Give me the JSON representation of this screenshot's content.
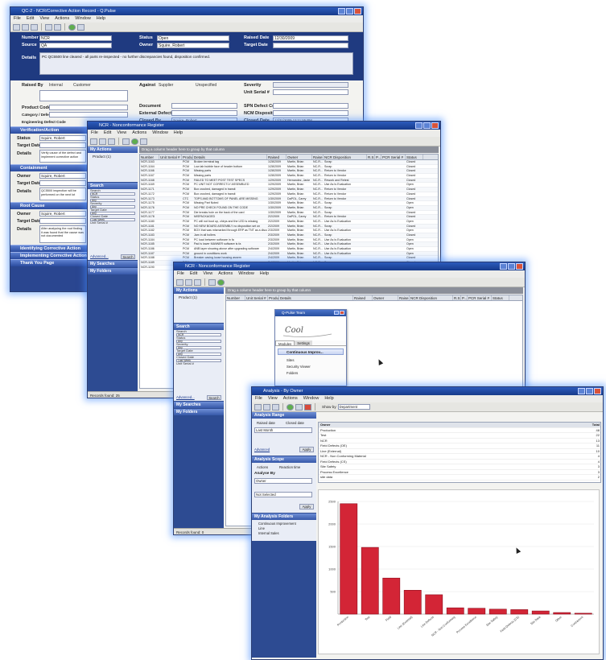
{
  "colors": {
    "navy": "#1c3474",
    "title_blue": "#2c5bbd",
    "glow": "#4b8cff",
    "bar_red": "#d32536",
    "group_gray": "#8b8f99"
  },
  "window1": {
    "title": "QC-2 - NCR/Corrective Action Record - Q.Pulse",
    "menu": [
      "File",
      "Edit",
      "View",
      "Actions",
      "Window",
      "Help"
    ],
    "fields": {
      "number_label": "Number",
      "number_value": "NCR",
      "source_label": "Source",
      "source_value": "QA",
      "status_label": "Status",
      "status_value": "Open",
      "owner_label": "Owner",
      "owner_value": "Squire, Robert",
      "raised_date_label": "Raised Date",
      "raised_date_value": "12/30/2009",
      "target_date_label": "Target Date",
      "details_label": "Details",
      "raised_by_label": "Raised By",
      "against_label": "Against",
      "severity_label": "Severity",
      "unit_serial_label": "Unit Serial #",
      "product_code_label": "Product Code",
      "category_label": "Category / Defect Code",
      "engineering_label": "Engineering Defect Code",
      "document_label": "Document",
      "external_ref_label": "External Defect Code",
      "closed_by_label": "Closed By",
      "closed_by_value": "Squire, Robert",
      "closed_date_label": "Closed Date",
      "closed_date_value": "12/31/2009 12:11:55 PM",
      "spn_label": "SPN Defect Code",
      "ncm_label": "NCM Disposition",
      "internal_option": "Internal",
      "customer_option": "Customer",
      "supplier_option": "Supplier",
      "specified_option": "Unspecified"
    },
    "details_text": "PC QC5500 line cleared - all parts re-inspected - no further discrepancies found, disposition confirmed.",
    "sections": [
      {
        "title": "Verification/Action",
        "status_label": "Status",
        "status": "Open",
        "owner_label": "Owner",
        "owner": "Squire, Robert",
        "target_label": "Target Date",
        "details_label": "Details",
        "details": "Verify cause of the defect and implement corrective action"
      },
      {
        "title": "Containment",
        "status_label": "Status",
        "status": "Open",
        "owner_label": "Owner",
        "owner": "Squire, Robert",
        "target_label": "Target Date",
        "details_label": "Details",
        "details": "QC5500 inspection will be performed on the next lot"
      },
      {
        "title": "Root Cause",
        "status_label": "Status",
        "status": "Open",
        "owner_label": "Owner",
        "owner": "Squire, Robert",
        "target_label": "Target Date",
        "details_label": "Details",
        "details": "After analysing the root finding it was found that the cause was not documented"
      }
    ],
    "collapsed_sections": [
      "Identifying Corrective Action",
      "Implementing Corrective Action",
      "Thank You Page"
    ]
  },
  "window2": {
    "title": "NCR - Nonconformance Register",
    "menu": [
      "File",
      "Edit",
      "View",
      "Actions",
      "Window",
      "Help"
    ],
    "nav": {
      "my_actions": "My Actions",
      "actions_item": "Product (1)",
      "search": "Search",
      "search_button": "Search",
      "advanced": "Advanced...",
      "my_searches": "My Searches",
      "my_folders": "My Folders",
      "fields": [
        "Search",
        "NCR",
        "Status",
        "Any",
        "Severity",
        "Any",
        "Target Date",
        "Any",
        "Closed Date",
        "Last Week",
        "Unit Serial #"
      ]
    },
    "group_bar": "Drag a column header here to group by that column",
    "columns": [
      "Number",
      "Unit Serial #",
      "Produ...",
      "Details",
      "Raised",
      "Owner",
      "Raise...",
      "NCR Disposition",
      "R.S.",
      "P...",
      "PCR Serial #",
      "Status"
    ],
    "rows": [
      [
        "NCR-1163",
        "",
        "PCM",
        "Broken terminal tag",
        "1/28/2009",
        "Martin, Brian",
        "NC-R...",
        "Scrap",
        "",
        "",
        "",
        "Closed"
      ],
      [
        "NCR-1164",
        "",
        "PCM",
        "Low lab bubble face of header bottom",
        "1/28/2009",
        "Martin, Brian",
        "NC-R...",
        "Scrap",
        "",
        "",
        "",
        "Closed"
      ],
      [
        "NCR-1166",
        "",
        "PCM",
        "Missing parts",
        "1/28/2009",
        "Martin, Brian",
        "NC-R...",
        "Return to Vendor",
        "",
        "",
        "",
        "Closed"
      ],
      [
        "NCR-1167",
        "",
        "PCM",
        "Missing parts",
        "1/28/2009",
        "Martin, Brian",
        "NC-R...",
        "Return to Vendor",
        "",
        "",
        "",
        "Closed"
      ],
      [
        "NCR-1168",
        "",
        "PCM",
        "FAILED TO MEET POST TEST SPECS",
        "1/29/2009",
        "Hernandez, Janie",
        "NC-R...",
        "Rework and Retest",
        "",
        "",
        "",
        "Closed"
      ],
      [
        "NCR-1169",
        "",
        "PCM",
        "PC UNIT NOT CORRECTLY ASSEMBLED",
        "1/29/2009",
        "Martin, Brian",
        "NC-R...",
        "Use As Is Evaluation",
        "",
        "",
        "",
        "Open"
      ],
      [
        "NCR-1171",
        "",
        "PCM",
        "Box crushed, damaged in transit",
        "1/29/2009",
        "Martin, Brian",
        "NC-R...",
        "Return to Vendor",
        "",
        "",
        "",
        "Closed"
      ],
      [
        "NCR-1172",
        "",
        "PCM",
        "Box crushed, damaged in transit",
        "1/29/2009",
        "Martin, Brian",
        "NC-R...",
        "Return to Vendor",
        "",
        "",
        "",
        "Closed"
      ],
      [
        "NCR-1173",
        "",
        "CTC",
        "TOPS AND BOTTOMS OF PANEL ARE MISSING",
        "1/30/2009",
        "DaPOL, Carey",
        "NC-R...",
        "Return to Vendor",
        "",
        "",
        "",
        "Closed"
      ],
      [
        "NCR-1175",
        "",
        "PCM",
        "Missing Part Noted",
        "1/30/2009",
        "Martin, Brian",
        "NC-R...",
        "Scrap",
        "",
        "",
        "",
        "Open"
      ],
      [
        "NCR-1176",
        "",
        "PCM",
        "NO PRE CHECK FOUND ON THE CODE",
        "1/30/2009",
        "Martin, Brian",
        "NC-R...",
        "Scrap",
        "",
        "",
        "",
        "Open"
      ],
      [
        "NCR-1177",
        "",
        "PCM",
        "Die breaks hole on the back of the card",
        "1/30/2009",
        "Martin, Brian",
        "NC-R...",
        "Scrap",
        "",
        "",
        "",
        "Closed"
      ],
      [
        "NCR-1178",
        "",
        "PCM",
        "MISPACKAGED",
        "2/2/2009",
        "DaPOL, Carey",
        "NC-R...",
        "Return to Vendor",
        "",
        "",
        "",
        "Closed"
      ],
      [
        "NCR-1180",
        "",
        "PCM",
        "PC will not boot up, chirps and the LED is missing",
        "2/2/2009",
        "Martin, Brian",
        "NC-R...",
        "Use As Is Evaluation",
        "",
        "",
        "",
        "Open"
      ],
      [
        "NCR-1181",
        "",
        "PCM",
        "NO NEW BOARD ASSEMBLY no disposition set on",
        "2/2/2009",
        "Martin, Brian",
        "NC-R...",
        "Scrap",
        "",
        "",
        "",
        "Closed"
      ],
      [
        "NCR-1182",
        "",
        "PCM",
        "BOX that was mismarked through ERP as TNT as a discount",
        "2/3/2009",
        "Martin, Brian",
        "NC-R...",
        "Use As Is Evaluation",
        "",
        "",
        "",
        "Open"
      ],
      [
        "NCR-1183",
        "",
        "PCM",
        "Jam in all hollers",
        "2/3/2009",
        "Martin, Brian",
        "NC-R...",
        "Scrap",
        "",
        "",
        "",
        "Closed"
      ],
      [
        "NCR-1184",
        "",
        "PCM",
        "PC load between software in fa",
        "2/3/2009",
        "Martin, Brian",
        "NC-R...",
        "Use As Is Evaluation",
        "",
        "",
        "",
        "Open"
      ],
      [
        "NCR-1185",
        "",
        "PCM",
        "Pad is lower MANNER software is fa",
        "2/3/2009",
        "Martin, Brian",
        "NC-R...",
        "Use As Is Evaluation",
        "",
        "",
        "",
        "Open"
      ],
      [
        "NCR-1186",
        "",
        "PCM",
        "ANB layer showing above after upgrading software",
        "2/4/2009",
        "Martin, Brian",
        "NC-R...",
        "Use As Is Evaluation",
        "",
        "",
        "",
        "Open"
      ],
      [
        "NCR-1187",
        "",
        "PCM",
        "ground in conditions work",
        "2/4/2009",
        "Martin, Brian",
        "NC-R...",
        "Use As Is Evaluation",
        "",
        "",
        "",
        "Open"
      ],
      [
        "NCR-1188",
        "",
        "PCM",
        "Breaker casing loose housing assem",
        "2/4/2009",
        "Martin, Brian",
        "NC-R...",
        "Scrap",
        "",
        "",
        "",
        "Closed"
      ],
      [
        "NCR-1189",
        "",
        "PCM",
        "missing screw",
        "2/4/2009",
        "Martin, Brian",
        "NC-R...",
        "Scrap",
        "",
        "",
        "",
        "Closed"
      ],
      [
        "NCR-1190",
        "",
        "PCM",
        "dents and scratches",
        "2/5/2009",
        "Martin, Brian",
        "NC-R...",
        "Return to Vendor",
        "",
        "",
        "",
        "Closed"
      ]
    ],
    "status": "Records found: 25"
  },
  "window3": {
    "title": "NCR - Nonconformance Register",
    "menu": [
      "File",
      "Edit",
      "View",
      "Actions",
      "Window",
      "Help"
    ],
    "group_bar": "Drag a column header here to group by that column",
    "columns": [
      "Number",
      "Unit Serial #",
      "Produ...",
      "Details",
      "Raised",
      "Owner",
      "Raise...",
      "NCR Disposition",
      "R.S.",
      "P...",
      "PCR Serial #",
      "Status"
    ],
    "nav": {
      "my_actions": "My Actions",
      "actions_item": "Product (1)",
      "search": "Search",
      "search_button": "Search",
      "advanced": "Advanced...",
      "my_searches": "My Searches",
      "my_folders": "My Folders",
      "fields": [
        "Search",
        "NCR",
        "Status",
        "Any",
        "Severity",
        "Any",
        "Target Date",
        "Any",
        "Closed Date",
        "Last Week",
        "Unit Serial #"
      ]
    },
    "popup": {
      "title": "Q-Pulse Team",
      "tab1": "Modules",
      "tab2": "Settings",
      "item_header": "Continuous Improv...",
      "items": [
        "Sites",
        "Security Viewer",
        "Folders"
      ]
    },
    "status": "Records found: 0"
  },
  "window4": {
    "title": "Analysis - By Owner",
    "menu": [
      "File",
      "View",
      "Actions",
      "Window",
      "Help"
    ],
    "show_by_label": "Show by",
    "show_by_value": "Department",
    "left": {
      "analysis_range": "Analysis Range",
      "raised_date": "Raised date",
      "closed_date": "Closed date",
      "range_value": "Last Month",
      "advanced": "Advanced",
      "apply": "Apply",
      "analysis_scope": "Analysis Scope",
      "scope_a": "Actions",
      "scope_b": "Reaction time",
      "analyse_by": "Analyse By",
      "analyse_value": "Owner",
      "sub_value": "Not Selected",
      "apply2": "Apply",
      "my_folders": "My Analysis Folders",
      "folders": [
        "Continuous Improvement",
        "Line",
        "Internal Sales"
      ]
    },
    "list_header": [
      "Owner",
      "Total"
    ],
    "list": [
      [
        "Production",
        "48"
      ],
      [
        "Test",
        "22"
      ],
      [
        "NCR",
        "13"
      ],
      [
        "Field Defects (OE)",
        "11"
      ],
      [
        "Line (External)",
        "10"
      ],
      [
        "NCR - Non Conforming Material",
        "4"
      ],
      [
        "Field Defects (CS)",
        "4"
      ],
      [
        "Site Safety",
        "3"
      ],
      [
        "Process Excellence",
        "3"
      ],
      [
        "site data",
        "2"
      ]
    ]
  },
  "chart_data": {
    "type": "bar",
    "title": "",
    "xlabel": "",
    "ylabel": "",
    "ylim": [
      0,
      2500
    ],
    "yticks": [
      "2500",
      "2000",
      "1500",
      "1000",
      "500",
      ""
    ],
    "categories": [
      "Production",
      "Test",
      "Field",
      "Line (External)",
      "Line Defects",
      "NCR - Non Conforming",
      "Process Excellence",
      "Site Safety",
      "Field Defects (CS)",
      "Site Data",
      "Other",
      "Contractors"
    ],
    "values": [
      2450,
      1480,
      800,
      530,
      430,
      140,
      130,
      110,
      100,
      70,
      35,
      20
    ]
  }
}
